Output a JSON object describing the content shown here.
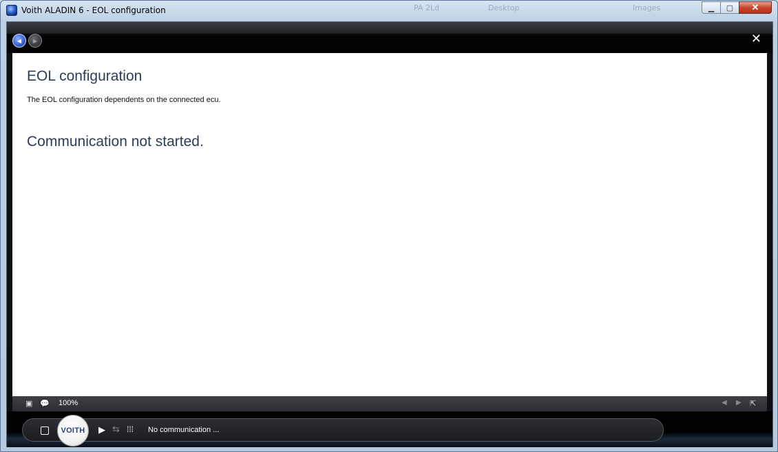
{
  "window": {
    "title": "Voith ALADIN 6 - EOL configuration",
    "ghost_labels": [
      "PA 2Ld",
      "Desktop",
      "Images"
    ],
    "minimize_glyph": "▁",
    "maximize_glyph": "▢",
    "close_glyph": "✕"
  },
  "toolbar": {
    "back_glyph": "◀",
    "forward_glyph": "▶",
    "close_glyph": "✕"
  },
  "content": {
    "title": "EOL configuration",
    "description": "The EOL configuration dependents on the connected ecu.",
    "communication_message": "Communication not started."
  },
  "statusbar": {
    "fit_glyph": "▣",
    "comment_glyph": "💬",
    "zoom": "100%",
    "prev_glyph": "◀",
    "next_glyph": "▶",
    "popout_glyph": "⇱"
  },
  "bottombar": {
    "logo_text": "VOITH",
    "play_glyph": "▶",
    "loop_glyph": "⇆",
    "grid_glyph": "⁞⁞⁞",
    "status": "No communication ..."
  }
}
